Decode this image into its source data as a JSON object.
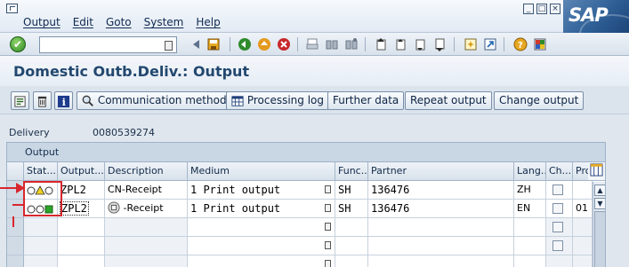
{
  "menu": {
    "items": [
      "Output",
      "Edit",
      "Goto",
      "System",
      "Help"
    ]
  },
  "window_controls": {
    "minimize_glyph": "_",
    "maximize_glyph": "□",
    "close_glyph": "×"
  },
  "logo": {
    "text": "SAP"
  },
  "standard_toolbar": {
    "enter_glyph": "✔",
    "command_field_value": ""
  },
  "page": {
    "title": "Domestic Outb.Deliv.: Output"
  },
  "app_toolbar": {
    "communication_method": "Communication method",
    "processing_log": "Processing log",
    "further_data": "Further data",
    "repeat_output": "Repeat output",
    "change_output": "Change output"
  },
  "delivery": {
    "label": "Delivery",
    "value": "0080539274"
  },
  "output_table": {
    "caption": "Output",
    "columns": [
      "Stat...",
      "Output...",
      "Description",
      "Medium",
      "Func...",
      "Partner",
      "Lang...",
      "Ch...",
      "Pro"
    ],
    "rows": [
      {
        "status": "yellow",
        "output": "ZPL2",
        "description": "CN-Receipt",
        "medium": "1 Print output",
        "func": "SH",
        "partner": "136476",
        "lang": "ZH",
        "ch": "",
        "pro": ""
      },
      {
        "status": "green",
        "output": "ZPL2",
        "description": "-Receipt",
        "medium": "1 Print output",
        "func": "SH",
        "partner": "136476",
        "lang": "EN",
        "ch": "",
        "pro": "01"
      }
    ],
    "empty_rows": 3
  },
  "colors": {
    "title": "#23486f",
    "highlight_red": "#d8262d",
    "lamp_yellow": "#f0d020",
    "lamp_green": "#2aa52a"
  }
}
